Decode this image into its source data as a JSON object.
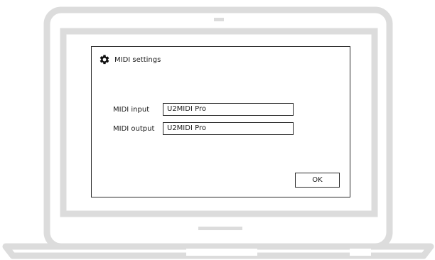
{
  "dialog": {
    "title": "MIDI settings",
    "title_icon": "gear-icon",
    "midi_input_label": "MIDI input",
    "midi_input_value": "U2MIDI Pro",
    "midi_output_label": "MIDI output",
    "midi_output_value": "U2MIDI Pro",
    "ok_label": "OK"
  },
  "colors": {
    "laptop_frame": "#dcdcdc",
    "dialog_border": "#2b2b2b",
    "text": "#1a1a1a"
  }
}
